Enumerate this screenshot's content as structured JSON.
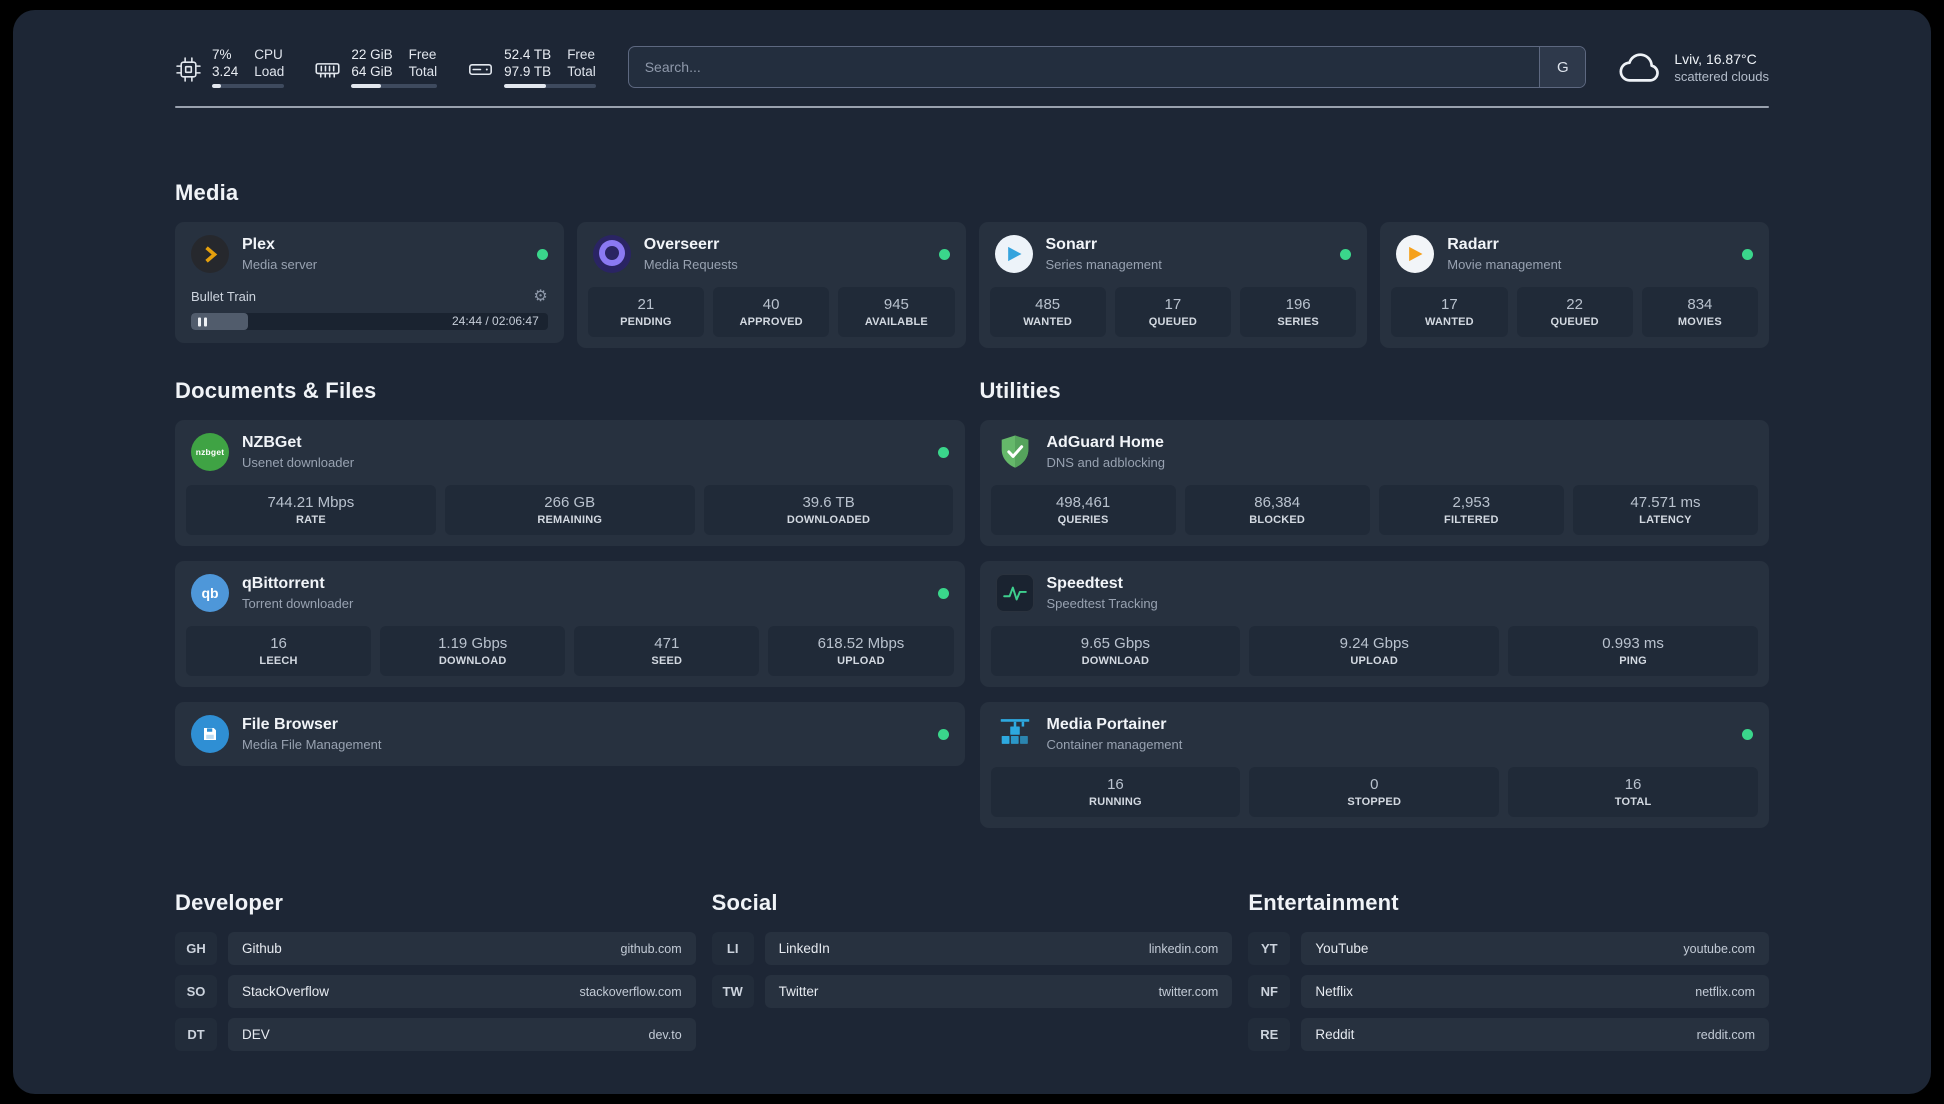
{
  "colors": {
    "background": "#1d2635",
    "card": "#27313f",
    "stat_box": "#202a38",
    "status_online": "#3ad68b",
    "accent_plex": "#e5a00d",
    "accent_sonarr": "#35a3dd",
    "accent_radarr": "#f5a11c",
    "accent_adguard": "#65b86a",
    "accent_speedtest": "#3ecf8e",
    "accent_portainer": "#2da9e0"
  },
  "topbar": {
    "system": [
      {
        "icon": "cpu-icon",
        "values": [
          "7%",
          "3.24"
        ],
        "labels": [
          "CPU",
          "Load"
        ],
        "progress_pct": 13
      },
      {
        "icon": "memory-icon",
        "values": [
          "22 GiB",
          "64 GiB"
        ],
        "labels": [
          "Free",
          "Total"
        ],
        "progress_pct": 34
      },
      {
        "icon": "disk-icon",
        "values": [
          "52.4 TB",
          "97.9 TB"
        ],
        "labels": [
          "Free",
          "Total"
        ],
        "progress_pct": 46
      }
    ],
    "search": {
      "placeholder": "Search...",
      "provider_label": "G"
    },
    "weather": {
      "icon": "cloud-icon",
      "location": "Lviv, 16.87°C",
      "condition": "scattered clouds"
    }
  },
  "sections": {
    "media": {
      "title": "Media",
      "cards": [
        {
          "id": "plex",
          "icon": "plex-icon",
          "name": "Plex",
          "description": "Media server",
          "online": true,
          "now_playing": {
            "title": "Bullet Train",
            "time_display": "24:44 / 02:06:47",
            "progress_pct": 16
          }
        },
        {
          "id": "overseerr",
          "icon": "overseerr-icon",
          "name": "Overseerr",
          "description": "Media Requests",
          "online": true,
          "stats": [
            {
              "value": "21",
              "label": "PENDING"
            },
            {
              "value": "40",
              "label": "APPROVED"
            },
            {
              "value": "945",
              "label": "AVAILABLE"
            }
          ]
        },
        {
          "id": "sonarr",
          "icon": "sonarr-icon",
          "name": "Sonarr",
          "description": "Series management",
          "online": true,
          "stats": [
            {
              "value": "485",
              "label": "WANTED"
            },
            {
              "value": "17",
              "label": "QUEUED"
            },
            {
              "value": "196",
              "label": "SERIES"
            }
          ]
        },
        {
          "id": "radarr",
          "icon": "radarr-icon",
          "name": "Radarr",
          "description": "Movie management",
          "online": true,
          "stats": [
            {
              "value": "17",
              "label": "WANTED"
            },
            {
              "value": "22",
              "label": "QUEUED"
            },
            {
              "value": "834",
              "label": "MOVIES"
            }
          ]
        }
      ]
    },
    "documents": {
      "title": "Documents & Files",
      "cards": [
        {
          "id": "nzbget",
          "icon": "nzbget-icon",
          "name": "NZBGet",
          "description": "Usenet downloader",
          "online": true,
          "stats": [
            {
              "value": "744.21 Mbps",
              "label": "RATE"
            },
            {
              "value": "266 GB",
              "label": "REMAINING"
            },
            {
              "value": "39.6 TB",
              "label": "DOWNLOADED"
            }
          ]
        },
        {
          "id": "qbittorrent",
          "icon": "qbittorrent-icon",
          "name": "qBittorrent",
          "description": "Torrent downloader",
          "online": true,
          "stats": [
            {
              "value": "16",
              "label": "LEECH"
            },
            {
              "value": "1.19 Gbps",
              "label": "DOWNLOAD"
            },
            {
              "value": "471",
              "label": "SEED"
            },
            {
              "value": "618.52 Mbps",
              "label": "UPLOAD"
            }
          ]
        },
        {
          "id": "filebrowser",
          "icon": "filebrowser-icon",
          "name": "File Browser",
          "description": "Media File Management",
          "online": true,
          "stats": []
        }
      ]
    },
    "utilities": {
      "title": "Utilities",
      "cards": [
        {
          "id": "adguard",
          "icon": "adguard-icon",
          "name": "AdGuard Home",
          "description": "DNS and adblocking",
          "online": false,
          "stats": [
            {
              "value": "498,461",
              "label": "QUERIES"
            },
            {
              "value": "86,384",
              "label": "BLOCKED"
            },
            {
              "value": "2,953",
              "label": "FILTERED"
            },
            {
              "value": "47.571 ms",
              "label": "LATENCY"
            }
          ]
        },
        {
          "id": "speedtest",
          "icon": "speedtest-icon",
          "name": "Speedtest",
          "description": "Speedtest Tracking",
          "online": false,
          "stats": [
            {
              "value": "9.65 Gbps",
              "label": "DOWNLOAD"
            },
            {
              "value": "9.24 Gbps",
              "label": "UPLOAD"
            },
            {
              "value": "0.993 ms",
              "label": "PING"
            }
          ]
        },
        {
          "id": "portainer",
          "icon": "portainer-icon",
          "name": "Media Portainer",
          "description": "Container management",
          "online": true,
          "stats": [
            {
              "value": "16",
              "label": "RUNNING"
            },
            {
              "value": "0",
              "label": "STOPPED"
            },
            {
              "value": "16",
              "label": "TOTAL"
            }
          ]
        }
      ]
    }
  },
  "bookmarks": [
    {
      "title": "Developer",
      "items": [
        {
          "abbr": "GH",
          "name": "Github",
          "url": "github.com"
        },
        {
          "abbr": "SO",
          "name": "StackOverflow",
          "url": "stackoverflow.com"
        },
        {
          "abbr": "DT",
          "name": "DEV",
          "url": "dev.to"
        }
      ]
    },
    {
      "title": "Social",
      "items": [
        {
          "abbr": "LI",
          "name": "LinkedIn",
          "url": "linkedin.com"
        },
        {
          "abbr": "TW",
          "name": "Twitter",
          "url": "twitter.com"
        }
      ]
    },
    {
      "title": "Entertainment",
      "items": [
        {
          "abbr": "YT",
          "name": "YouTube",
          "url": "youtube.com"
        },
        {
          "abbr": "NF",
          "name": "Netflix",
          "url": "netflix.com"
        },
        {
          "abbr": "RE",
          "name": "Reddit",
          "url": "reddit.com"
        }
      ]
    }
  ]
}
